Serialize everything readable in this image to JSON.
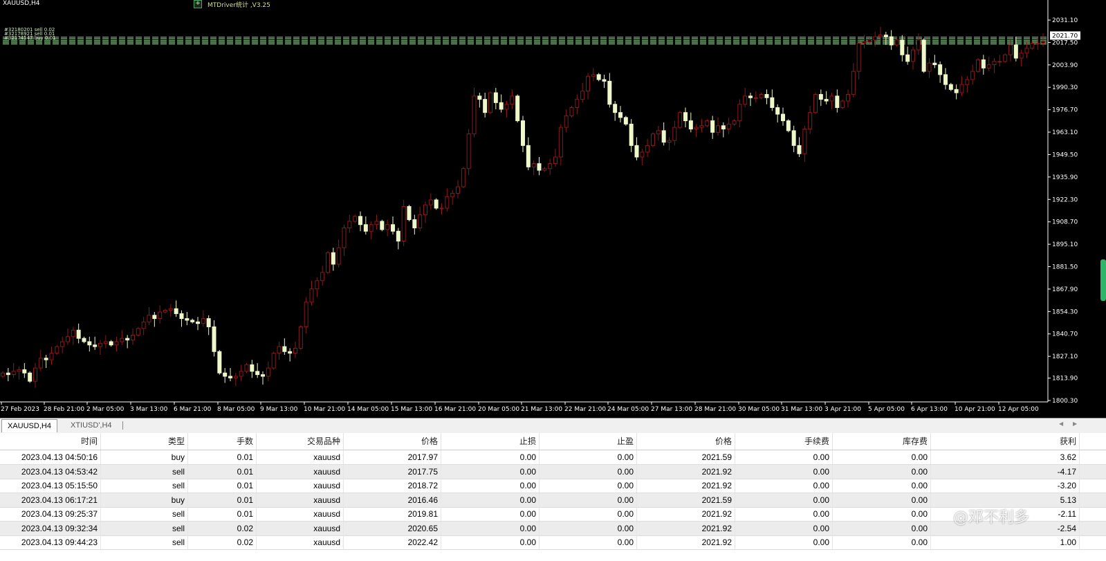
{
  "chart": {
    "symbol_title": "XAUUSD,H4",
    "indicator_title": "MTDriver统计 ,V3.25",
    "indicator_icon": "+",
    "order_line_labels": [
      "#32180201 sell 0.02",
      "#32178921 sell 0.01",
      "#32174547 buy 0.01"
    ],
    "current_price": "2021.70",
    "colors": {
      "bull": "#8b1a1a",
      "bear": "#eef8c8",
      "grid_line": "#7fd37f",
      "axis": "#ffffff"
    }
  },
  "chart_data": {
    "type": "candlestick",
    "y_ticks": [
      "2031.10",
      "2017.50",
      "2003.90",
      "1990.30",
      "1976.70",
      "1963.10",
      "1949.50",
      "1935.90",
      "1922.30",
      "1908.70",
      "1895.10",
      "1881.50",
      "1867.90",
      "1854.30",
      "1840.70",
      "1827.10",
      "1813.90",
      "1800.30"
    ],
    "ylim": [
      1800.3,
      2031.1
    ],
    "x_labels": [
      "27 Feb 2023",
      "28 Feb 21:00",
      "2 Mar 05:00",
      "3 Mar 13:00",
      "6 Mar 21:00",
      "8 Mar 05:00",
      "9 Mar 13:00",
      "10 Mar 21:00",
      "14 Mar 05:00",
      "15 Mar 13:00",
      "16 Mar 21:00",
      "20 Mar 05:00",
      "21 Mar 13:00",
      "22 Mar 21:00",
      "24 Mar 05:00",
      "27 Mar 13:00",
      "28 Mar 21:00",
      "30 Mar 05:00",
      "31 Mar 13:00",
      "3 Apr 21:00",
      "5 Apr 05:00",
      "6 Apr 13:00",
      "10 Apr 21:00",
      "12 Apr 05:00"
    ],
    "closes": [
      1817,
      1816,
      1818,
      1819,
      1817,
      1812,
      1820,
      1826,
      1825,
      1829,
      1833,
      1836,
      1839,
      1843,
      1838,
      1836,
      1834,
      1833,
      1835,
      1836,
      1834,
      1836,
      1838,
      1837,
      1840,
      1844,
      1848,
      1852,
      1850,
      1854,
      1855,
      1856,
      1853,
      1850,
      1849,
      1848,
      1847,
      1850,
      1845,
      1830,
      1817,
      1815,
      1814,
      1815,
      1818,
      1822,
      1818,
      1816,
      1815,
      1820,
      1829,
      1833,
      1830,
      1829,
      1832,
      1845,
      1860,
      1868,
      1873,
      1878,
      1890,
      1883,
      1893,
      1905,
      1909,
      1912,
      1907,
      1903,
      1907,
      1909,
      1904,
      1907,
      1903,
      1897,
      1918,
      1910,
      1905,
      1913,
      1919,
      1922,
      1917,
      1917,
      1924,
      1926,
      1930,
      1941,
      1962,
      1985,
      1983,
      1975,
      1987,
      1981,
      1977,
      1980,
      1985,
      1970,
      1955,
      1942,
      1944,
      1940,
      1941,
      1944,
      1948,
      1966,
      1973,
      1978,
      1983,
      1988,
      1997,
      1998,
      1995,
      1994,
      1980,
      1975,
      1972,
      1968,
      1955,
      1948,
      1951,
      1955,
      1962,
      1964,
      1957,
      1958,
      1966,
      1975,
      1970,
      1965,
      1966,
      1967,
      1970,
      1963,
      1967,
      1965,
      1968,
      1970,
      1980,
      1985,
      1984,
      1984,
      1986,
      1984,
      1978,
      1974,
      1970,
      1964,
      1955,
      1950,
      1965,
      1975,
      1986,
      1983,
      1982,
      1985,
      1978,
      1982,
      1986,
      2000,
      2017,
      2018,
      2019,
      2021,
      2022,
      2021,
      2016,
      2019,
      2010,
      2006,
      2013,
      2019,
      2000,
      2005,
      2004,
      1998,
      1992,
      1989,
      1987,
      1992,
      1995,
      2000,
      2007,
      2002,
      2004,
      2006,
      2006,
      2010,
      2016,
      2008,
      2011,
      2014,
      2017,
      2017,
      2018
    ]
  },
  "tabs": [
    {
      "label": "XAUUSD,H4",
      "active": true
    },
    {
      "label": "XTIUSD',H4",
      "active": false
    }
  ],
  "table": {
    "columns": [
      "时间",
      "类型",
      "手数",
      "交易品种",
      "价格",
      "止损",
      "止盈",
      "价格",
      "手续费",
      "库存费",
      "获利"
    ],
    "rows": [
      [
        "2023.04.13 04:50:16",
        "buy",
        "0.01",
        "xauusd",
        "2017.97",
        "0.00",
        "0.00",
        "2021.59",
        "0.00",
        "0.00",
        "3.62"
      ],
      [
        "2023.04.13 04:53:42",
        "sell",
        "0.01",
        "xauusd",
        "2017.75",
        "0.00",
        "0.00",
        "2021.92",
        "0.00",
        "0.00",
        "-4.17"
      ],
      [
        "2023.04.13 05:15:50",
        "sell",
        "0.01",
        "xauusd",
        "2018.72",
        "0.00",
        "0.00",
        "2021.92",
        "0.00",
        "0.00",
        "-3.20"
      ],
      [
        "2023.04.13 06:17:21",
        "buy",
        "0.01",
        "xauusd",
        "2016.46",
        "0.00",
        "0.00",
        "2021.59",
        "0.00",
        "0.00",
        "5.13"
      ],
      [
        "2023.04.13 09:25:37",
        "sell",
        "0.01",
        "xauusd",
        "2019.81",
        "0.00",
        "0.00",
        "2021.92",
        "0.00",
        "0.00",
        "-2.11"
      ],
      [
        "2023.04.13 09:32:34",
        "sell",
        "0.02",
        "xauusd",
        "2020.65",
        "0.00",
        "0.00",
        "2021.92",
        "0.00",
        "0.00",
        "-2.54"
      ],
      [
        "2023.04.13 09:44:23",
        "sell",
        "0.02",
        "xauusd",
        "2022.42",
        "0.00",
        "0.00",
        "2021.92",
        "0.00",
        "0.00",
        "1.00"
      ]
    ]
  },
  "watermark": "@邓不利多"
}
